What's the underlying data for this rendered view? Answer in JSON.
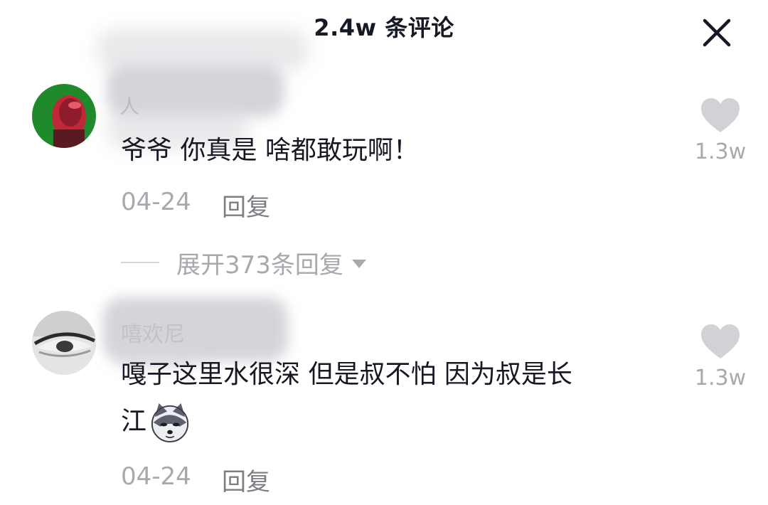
{
  "header": {
    "title": "2.4w 条评论"
  },
  "close": {
    "icon": "close-icon"
  },
  "comments": [
    {
      "username": "人",
      "text": "爷爷 你真是 啥都敢玩啊！",
      "date": "04-24",
      "reply_label": "回复",
      "likes": "1.3w",
      "expand_label": "展开373条回复"
    },
    {
      "username": "嘻欢尼",
      "text_line1": "嘎子这里水很深 但是叔不怕 因为叔是长",
      "text_line2": "江",
      "emoji": "husky-dog-emoji",
      "date": "04-24",
      "reply_label": "回复",
      "likes": "1.3w"
    }
  ],
  "colors": {
    "text_primary": "#161823",
    "text_secondary": "#a8a8ae",
    "reply": "#7d7d84",
    "heart": "#d2d2d6"
  }
}
